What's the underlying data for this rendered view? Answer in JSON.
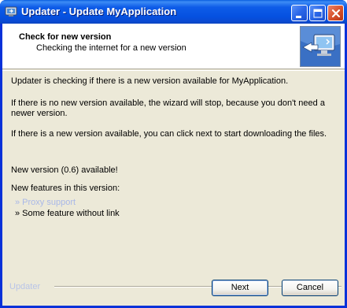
{
  "window": {
    "title": "Updater - Update MyApplication",
    "icons": {
      "app": "updater-app-icon",
      "minimize": "minimize-icon",
      "maximize": "maximize-icon",
      "close": "close-icon",
      "header": "monitor-arrow-icon"
    },
    "colors": {
      "titlebar": "#0a5fe0",
      "client": "#ece9d8",
      "link": "#a9b8e8"
    }
  },
  "header": {
    "title": "Check for new version",
    "subtitle": "Checking the internet for a new version"
  },
  "body": {
    "paragraph1": "Updater is checking if there is a new version available for MyApplication.",
    "paragraph2": "If there is no new version available, the wizard will stop, because you don't need a newer version.",
    "paragraph3": "If there is a new version available, you can click next to start downloading the files.",
    "new_version": "New version (0.6) available!",
    "features_heading": "New features in this version:",
    "features": [
      "» Proxy support",
      "» Some feature without link"
    ]
  },
  "footer": {
    "brand": "Updater",
    "next_label": "Next",
    "cancel_label": "Cancel"
  }
}
